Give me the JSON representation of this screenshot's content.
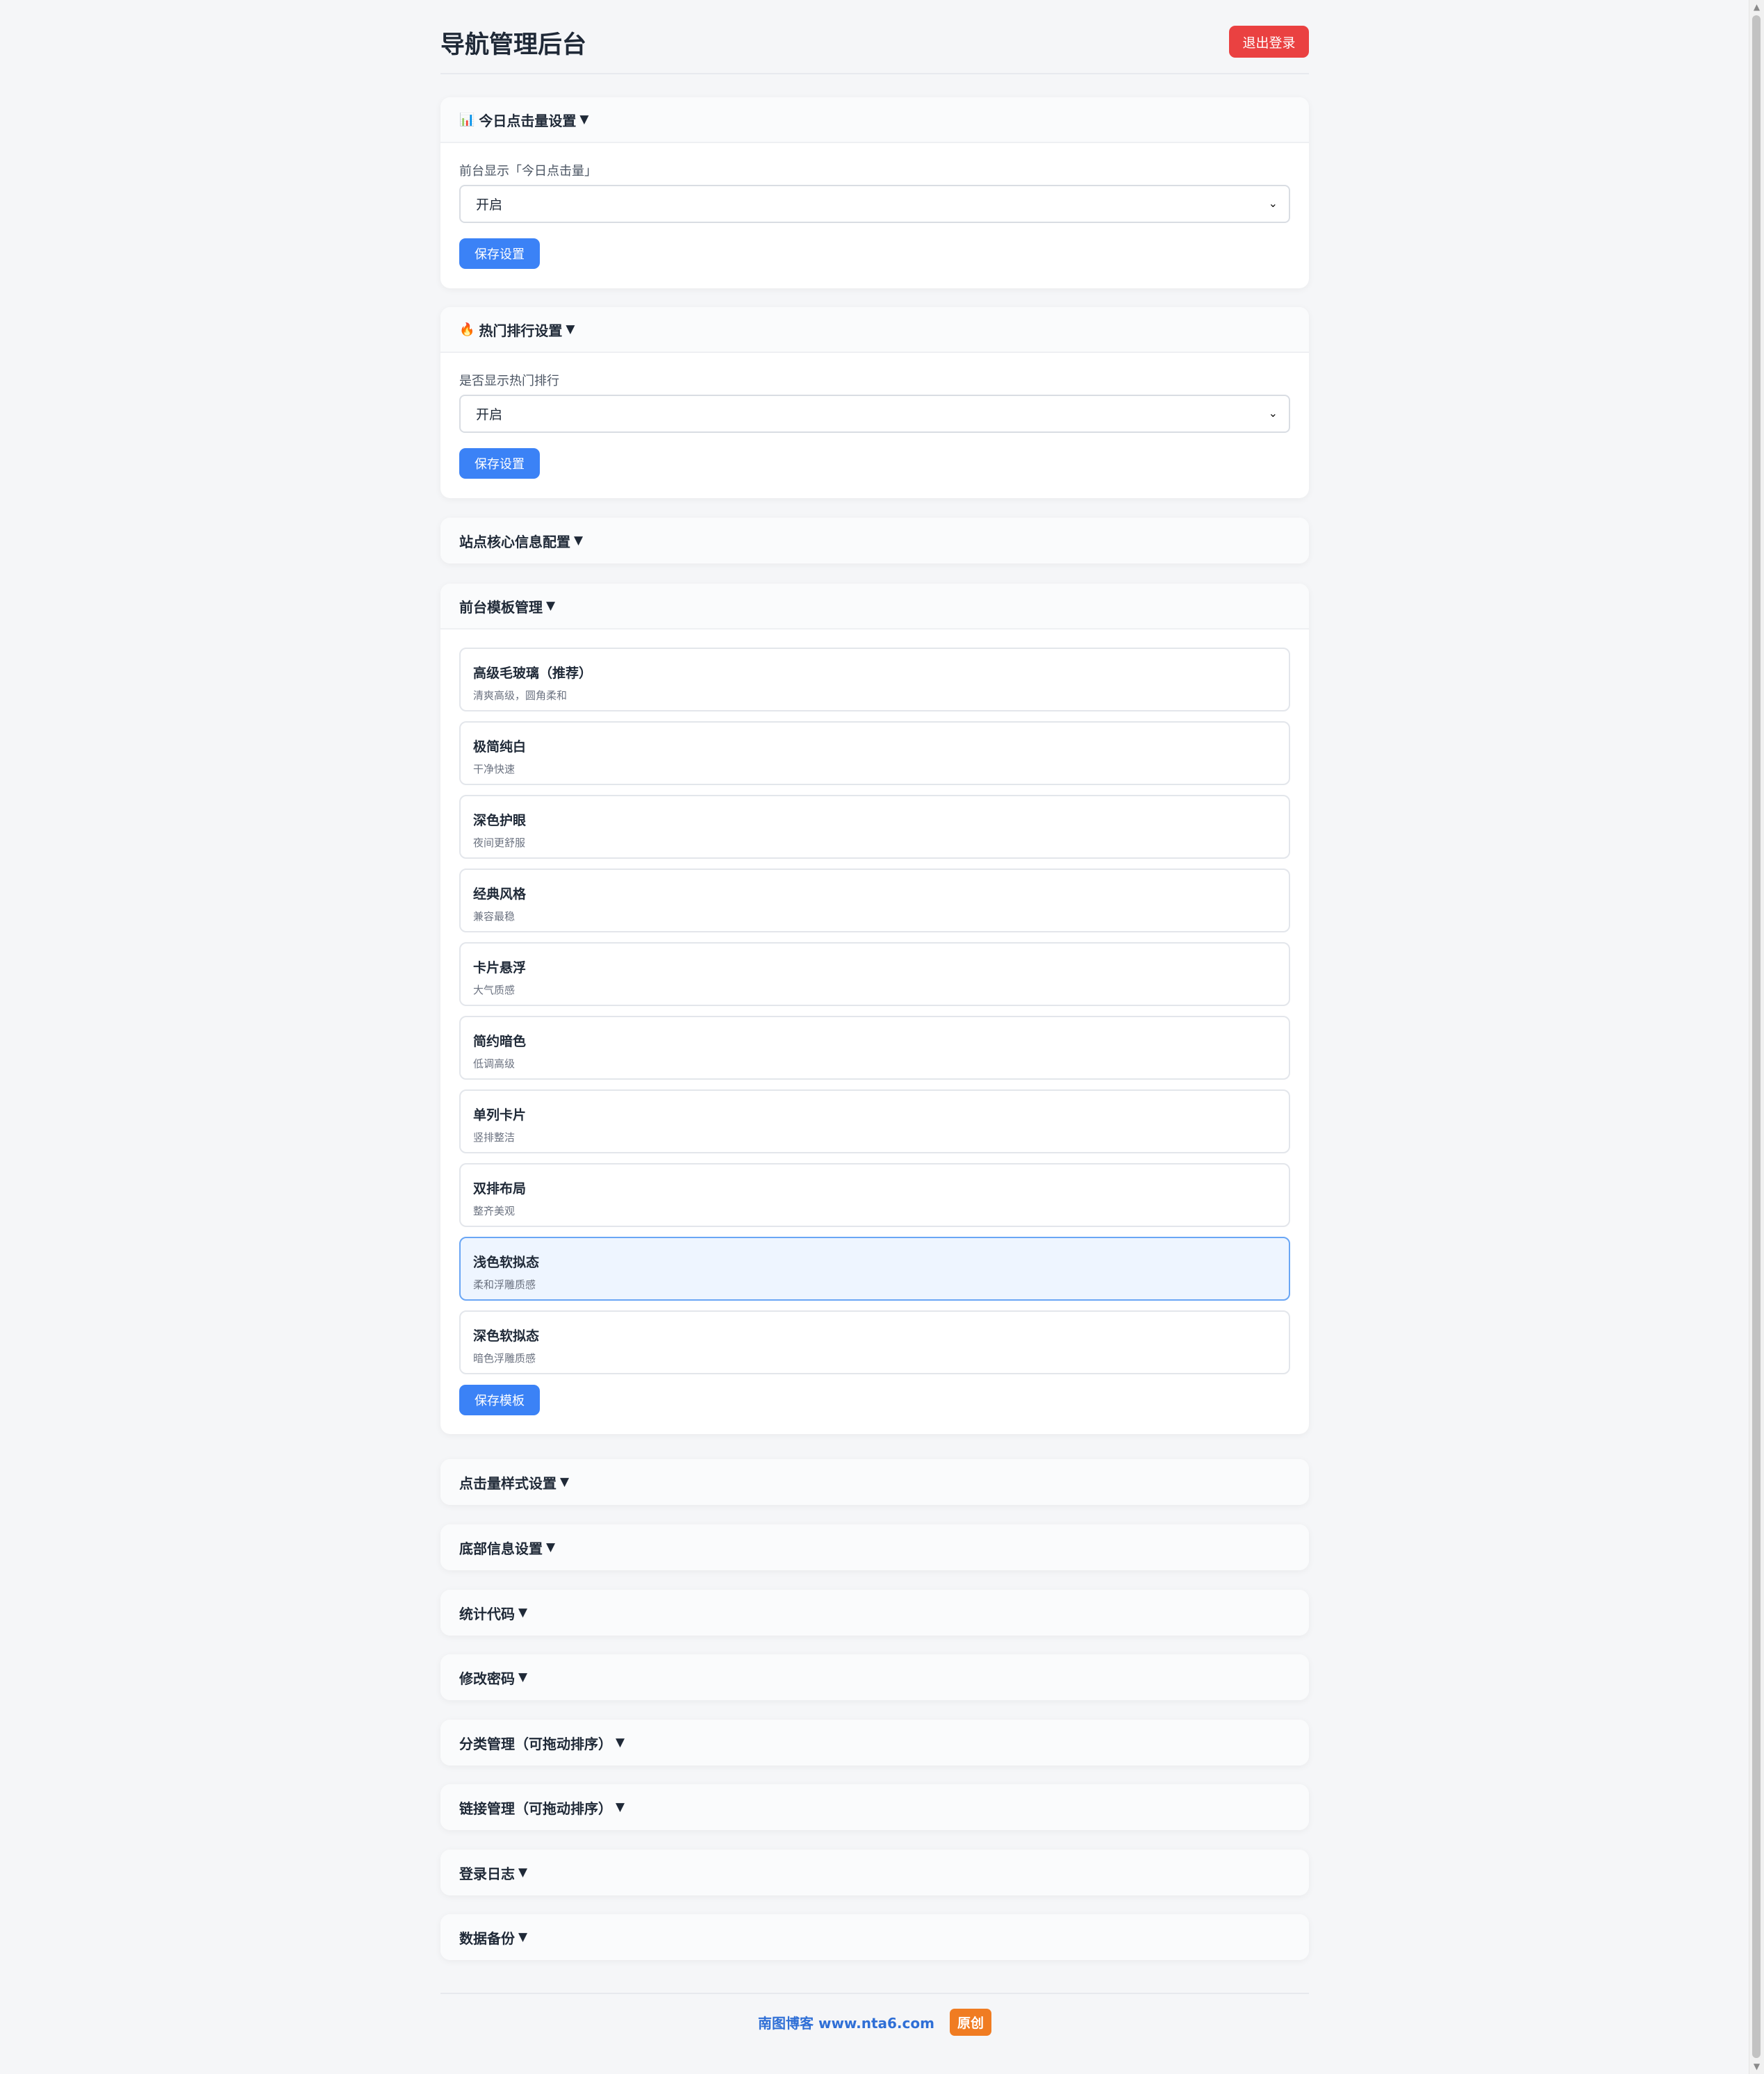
{
  "header": {
    "title": "导航管理后台",
    "logout_label": "退出登录"
  },
  "sections": {
    "today_clicks": {
      "icon": "📊",
      "title": "今日点击量设置",
      "caret": "▼",
      "field_label": "前台显示「今日点击量」",
      "select_value": "开启",
      "save_label": "保存设置"
    },
    "hot_ranking": {
      "icon": "🔥",
      "title": "热门排行设置",
      "caret": "▼",
      "field_label": "是否显示热门排行",
      "select_value": "开启",
      "save_label": "保存设置"
    },
    "site_core": {
      "title": "站点核心信息配置",
      "caret": "▼"
    },
    "templates": {
      "title": "前台模板管理",
      "caret": "▼",
      "items": [
        {
          "name": "高级毛玻璃（推荐）",
          "desc": "清爽高级，圆角柔和",
          "active": false
        },
        {
          "name": "极简纯白",
          "desc": "干净快速",
          "active": false
        },
        {
          "name": "深色护眼",
          "desc": "夜间更舒服",
          "active": false
        },
        {
          "name": "经典风格",
          "desc": "兼容最稳",
          "active": false
        },
        {
          "name": "卡片悬浮",
          "desc": "大气质感",
          "active": false
        },
        {
          "name": "简约暗色",
          "desc": "低调高级",
          "active": false
        },
        {
          "name": "单列卡片",
          "desc": "竖排整洁",
          "active": false
        },
        {
          "name": "双排布局",
          "desc": "整齐美观",
          "active": false
        },
        {
          "name": "浅色软拟态",
          "desc": "柔和浮雕质感",
          "active": true
        },
        {
          "name": "深色软拟态",
          "desc": "暗色浮雕质感",
          "active": false
        }
      ],
      "save_label": "保存模板"
    },
    "click_style": {
      "title": "点击量样式设置",
      "caret": "▼"
    },
    "footer_info": {
      "title": "底部信息设置",
      "caret": "▼"
    },
    "stats_code": {
      "title": "统计代码",
      "caret": "▼"
    },
    "change_password": {
      "title": "修改密码",
      "caret": "▼"
    },
    "category_mgmt": {
      "title": "分类管理（可拖动排序）",
      "caret": "▼"
    },
    "link_mgmt": {
      "title": "链接管理（可拖动排序）",
      "caret": "▼"
    },
    "login_log": {
      "title": "登录日志",
      "caret": "▼"
    },
    "data_backup": {
      "title": "数据备份",
      "caret": "▼"
    }
  },
  "footer": {
    "link_text": "南图博客 www.nta6.com",
    "badge": "原创"
  },
  "colors": {
    "primary": "#3b82f6",
    "danger": "#ea4141",
    "badge": "#f07c22",
    "active_bg": "#eef5ff"
  }
}
